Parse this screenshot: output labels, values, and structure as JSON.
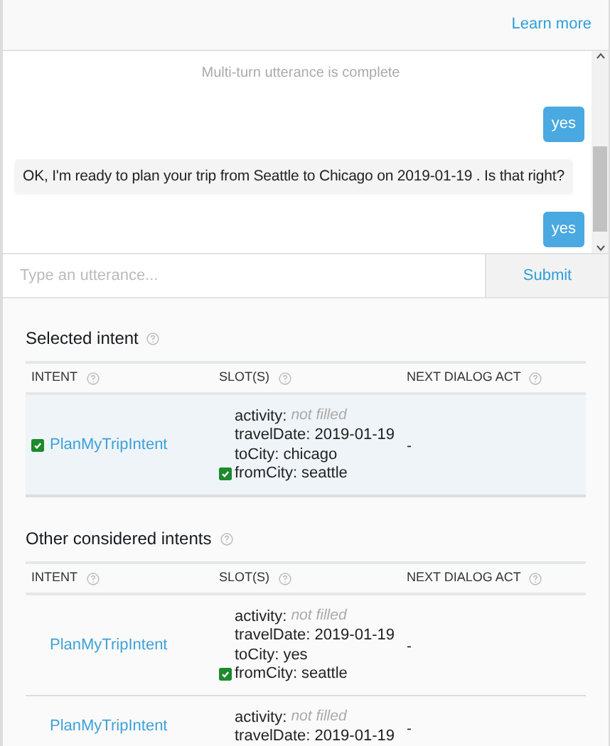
{
  "header": {
    "link": "Learn more"
  },
  "chat": {
    "status": "Multi-turn utterance is complete",
    "messages": [
      {
        "kind": "user",
        "text": "yes"
      },
      {
        "kind": "bot",
        "text": "OK, I'm ready to plan your trip from Seattle to Chicago on 2019-01-19 . Is that right?"
      },
      {
        "kind": "user",
        "text": "yes"
      }
    ]
  },
  "input": {
    "placeholder": "Type an utterance...",
    "button": "Submit"
  },
  "sections": [
    {
      "title": "Selected intent",
      "highlighted": true,
      "columns": [
        "INTENT",
        "SLOT(S)",
        "NEXT DIALOG ACT"
      ],
      "rows": [
        {
          "intent": "PlanMyTripIntent",
          "confirmed": true,
          "next_dialog_act": "-",
          "slots": [
            {
              "name": "activity:",
              "value": "not filled",
              "filled": false,
              "confirmed": false
            },
            {
              "name": "travelDate:",
              "value": "2019-01-19",
              "filled": true,
              "confirmed": false
            },
            {
              "name": "toCity:",
              "value": "chicago",
              "filled": true,
              "confirmed": false
            },
            {
              "name": "fromCity:",
              "value": "seattle",
              "filled": true,
              "confirmed": true
            }
          ]
        }
      ]
    },
    {
      "title": "Other considered intents",
      "highlighted": false,
      "columns": [
        "INTENT",
        "SLOT(S)",
        "NEXT DIALOG ACT"
      ],
      "rows": [
        {
          "intent": "PlanMyTripIntent",
          "confirmed": false,
          "next_dialog_act": "-",
          "slots": [
            {
              "name": "activity:",
              "value": "not filled",
              "filled": false,
              "confirmed": false
            },
            {
              "name": "travelDate:",
              "value": "2019-01-19",
              "filled": true,
              "confirmed": false
            },
            {
              "name": "toCity:",
              "value": "yes",
              "filled": true,
              "confirmed": false
            },
            {
              "name": "fromCity:",
              "value": "seattle",
              "filled": true,
              "confirmed": true
            }
          ]
        },
        {
          "intent": "PlanMyTripIntent",
          "confirmed": false,
          "next_dialog_act": "-",
          "slots": [
            {
              "name": "activity:",
              "value": "not filled",
              "filled": false,
              "confirmed": false
            },
            {
              "name": "travelDate:",
              "value": "2019-01-19",
              "filled": true,
              "confirmed": false
            }
          ]
        }
      ]
    }
  ]
}
